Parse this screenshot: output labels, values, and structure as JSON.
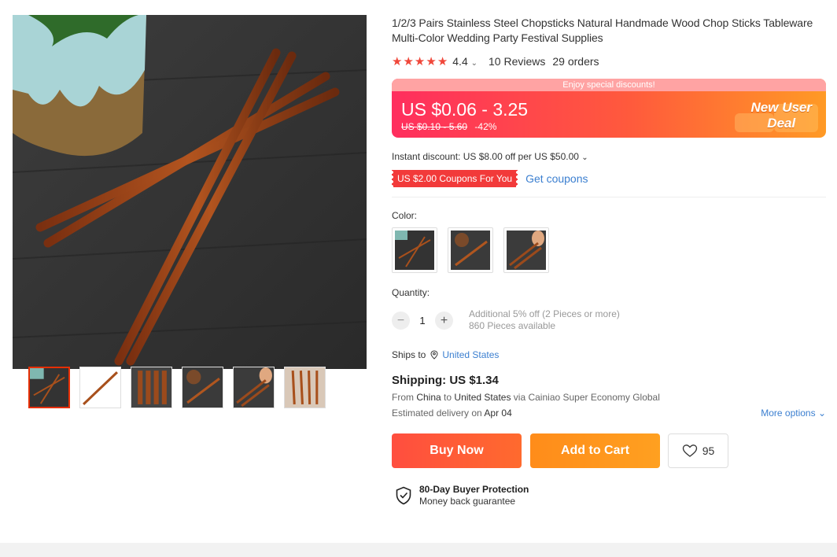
{
  "product": {
    "title": "1/2/3 Pairs Stainless Steel Chopsticks Natural Handmade Wood Chop Sticks Tableware Multi-Color Wedding Party Festival Supplies",
    "rating": "4.4",
    "rating_stars": 4.4,
    "reviews": "10 Reviews",
    "orders": "29 orders"
  },
  "banner": {
    "top_text": "Enjoy special discounts!",
    "price": "US $0.06 - 3.25",
    "old_price": "US $0.10 - 5.60",
    "discount": "-42%",
    "new_user_line1": "New User",
    "new_user_line2": "Deal"
  },
  "discount": {
    "instant": "Instant discount: US $8.00 off per US $50.00",
    "coupon": "US $2.00 Coupons For You",
    "get_coupons": "Get coupons"
  },
  "color": {
    "label": "Color:"
  },
  "quantity": {
    "label": "Quantity:",
    "value": "1",
    "minus": "−",
    "plus": "+",
    "additional": "Additional 5% off (2 Pieces or more)",
    "available": "860 Pieces available"
  },
  "shipping": {
    "ships_to_label": "Ships to",
    "country": "United States",
    "title": "Shipping: US $1.34",
    "from_prefix": "From",
    "from_country": "China",
    "to_word": "to",
    "to_country": "United States",
    "via": "via Cainiao Super Economy Global",
    "delivery_label": "Estimated delivery on",
    "delivery_date": "Apr 04",
    "more_options": "More options"
  },
  "actions": {
    "buy_now": "Buy Now",
    "add_to_cart": "Add to Cart",
    "wishlist_count": "95"
  },
  "protection": {
    "title": "80-Day Buyer Protection",
    "subtitle": "Money back guarantee"
  },
  "colors": {
    "accent": "#ff4747",
    "link": "#3b7fd0",
    "buy": "#ff5a3a",
    "cart": "#ff9a1e",
    "star": "#f0473a"
  },
  "icons": [
    "star-icon",
    "chevron-down-icon",
    "location-pin-icon",
    "heart-icon",
    "shield-check-icon"
  ]
}
